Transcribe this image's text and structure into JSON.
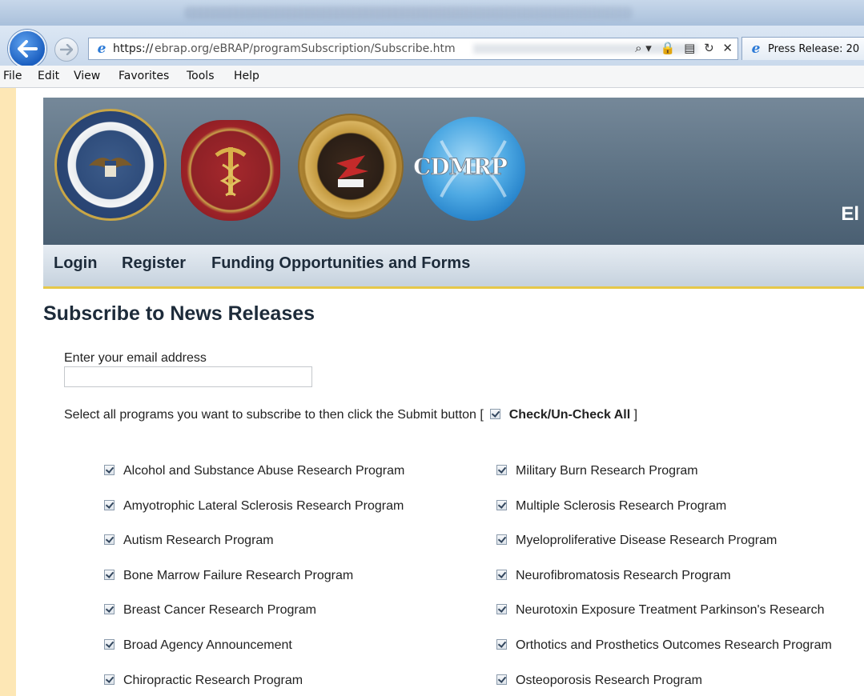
{
  "browser": {
    "url_scheme": "https://",
    "url_rest": "ebrap.org/eBRAP/programSubscription/Subscribe.htm",
    "address_icons": [
      "⌕ ▾",
      "🔒",
      "▤",
      "↻",
      "✕"
    ],
    "tab_title": "Press Release: 20",
    "menu": [
      "File",
      "Edit",
      "View",
      "Favorites",
      "Tools",
      "Help"
    ]
  },
  "banner": {
    "seals": [
      "department-of-defense-seal",
      "protect-project-sustain-seal",
      "usamraa-seal",
      "cdmrp-logo"
    ],
    "cdmrp_text": "CDMRP",
    "partial_text": "El"
  },
  "nav": {
    "login": "Login",
    "register": "Register",
    "funding": "Funding Opportunities and Forms"
  },
  "page": {
    "title": "Subscribe to News Releases",
    "email_label": "Enter your email address",
    "email_value": "",
    "instructions_prefix": "Select all programs you want to subscribe to then click the Submit button [",
    "check_all_label": "Check/Un-Check All",
    "instructions_suffix": "]",
    "check_all_checked": true
  },
  "programs_left": [
    {
      "label": "Alcohol and Substance Abuse Research Program",
      "checked": true
    },
    {
      "label": "Amyotrophic Lateral Sclerosis Research Program",
      "checked": true
    },
    {
      "label": "Autism Research Program",
      "checked": true
    },
    {
      "label": "Bone Marrow Failure Research Program",
      "checked": true
    },
    {
      "label": "Breast Cancer Research Program",
      "checked": true
    },
    {
      "label": "Broad Agency Announcement",
      "checked": true
    },
    {
      "label": "Chiropractic Research Program",
      "checked": true
    }
  ],
  "programs_right": [
    {
      "label": "Military Burn Research Program",
      "checked": true
    },
    {
      "label": "Multiple Sclerosis Research Program",
      "checked": true
    },
    {
      "label": "Myeloproliferative Disease Research Program",
      "checked": true
    },
    {
      "label": "Neurofibromatosis Research Program",
      "checked": true
    },
    {
      "label": "Neurotoxin Exposure Treatment Parkinson's Research",
      "checked": true
    },
    {
      "label": "Orthotics and Prosthetics Outcomes Research Program",
      "checked": true
    },
    {
      "label": "Osteoporosis Research Program",
      "checked": true
    }
  ]
}
